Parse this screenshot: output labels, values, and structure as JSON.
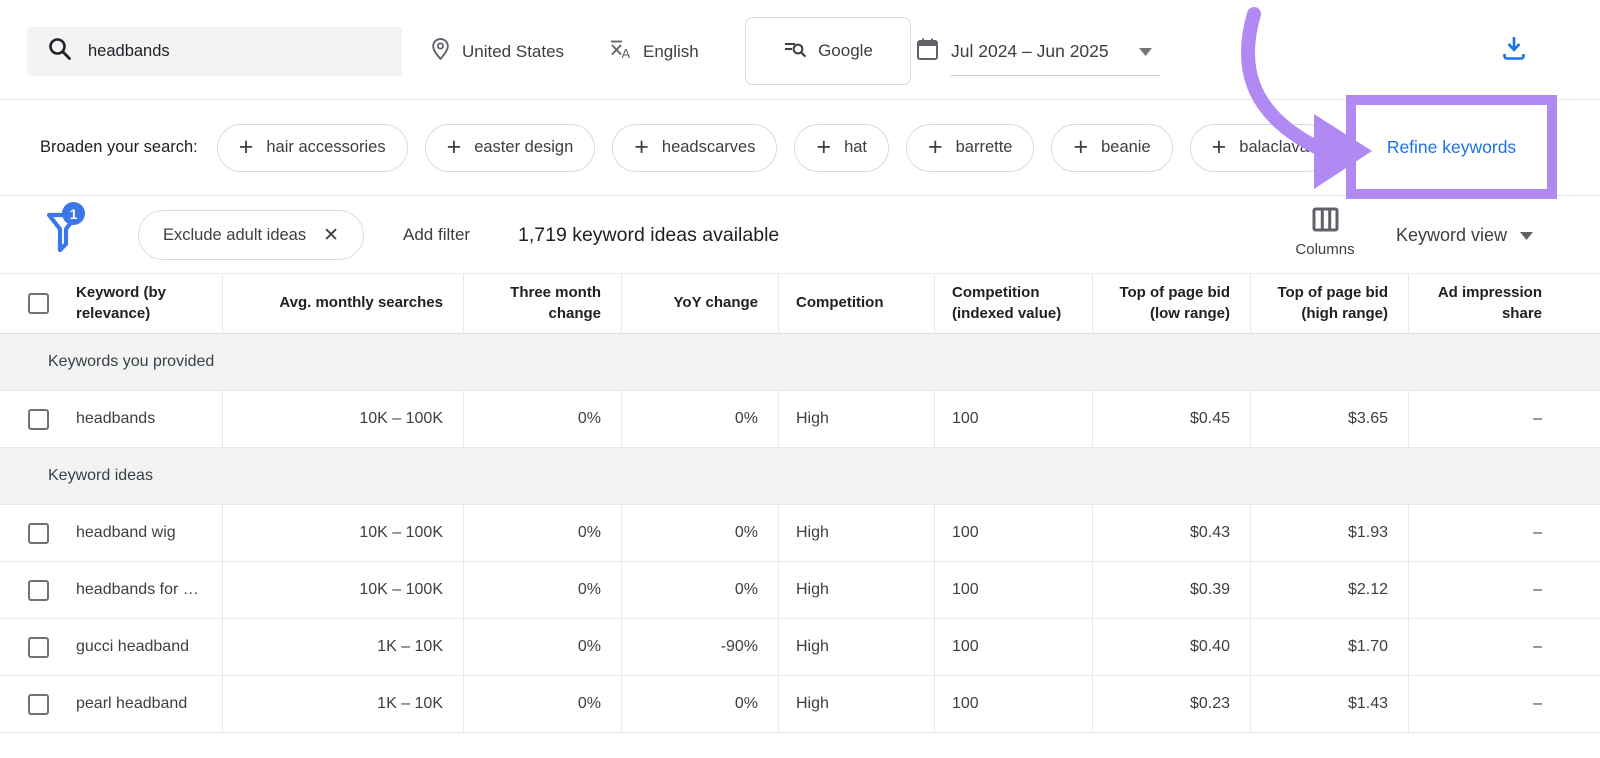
{
  "topbar": {
    "search_value": "headbands",
    "location": "United States",
    "language": "English",
    "network": "Google",
    "date_range": "Jul 2024 – Jun 2025"
  },
  "broaden": {
    "label": "Broaden your search:",
    "chips": [
      "hair accessories",
      "easter design",
      "headscarves",
      "hat",
      "barrette",
      "beanie",
      "balaclava"
    ],
    "refine_keywords_label": "Refine keywords"
  },
  "filter_bar": {
    "filter_count": "1",
    "active_filter": "Exclude adult ideas",
    "add_filter_label": "Add filter",
    "results_summary": "1,719 keyword ideas available",
    "columns_label": "Columns",
    "view_selector": "Keyword view"
  },
  "table": {
    "columns": [
      "Keyword (by relevance)",
      "Avg. monthly searches",
      "Three month change",
      "YoY change",
      "Competition",
      "Competition (indexed value)",
      "Top of page bid (low range)",
      "Top of page bid (high range)",
      "Ad impression share"
    ],
    "sections": [
      {
        "label": "Keywords you provided",
        "rows": [
          {
            "cells": [
              "headbands",
              "10K – 100K",
              "0%",
              "0%",
              "High",
              "100",
              "$0.45",
              "$3.65",
              "–"
            ]
          }
        ]
      },
      {
        "label": "Keyword ideas",
        "rows": [
          {
            "cells": [
              "headband wig",
              "10K – 100K",
              "0%",
              "0%",
              "High",
              "100",
              "$0.43",
              "$1.93",
              "–"
            ]
          },
          {
            "cells": [
              "headbands for …",
              "10K – 100K",
              "0%",
              "0%",
              "High",
              "100",
              "$0.39",
              "$2.12",
              "–"
            ]
          },
          {
            "cells": [
              "gucci headband",
              "1K – 10K",
              "0%",
              "-90%",
              "High",
              "100",
              "$0.40",
              "$1.70",
              "–"
            ]
          },
          {
            "cells": [
              "pearl headband",
              "1K – 10K",
              "0%",
              "0%",
              "High",
              "100",
              "$0.23",
              "$1.43",
              "–"
            ]
          }
        ]
      }
    ]
  },
  "colors": {
    "accent_blue": "#1a73e8",
    "annotation_purple": "#b189f2",
    "section_bg": "#f1f3f4",
    "chip_border": "#dadce0",
    "row_border": "#e9e9ea",
    "text_primary": "#202124",
    "text_secondary": "#3c4043",
    "icon_gray": "#5f6368"
  }
}
